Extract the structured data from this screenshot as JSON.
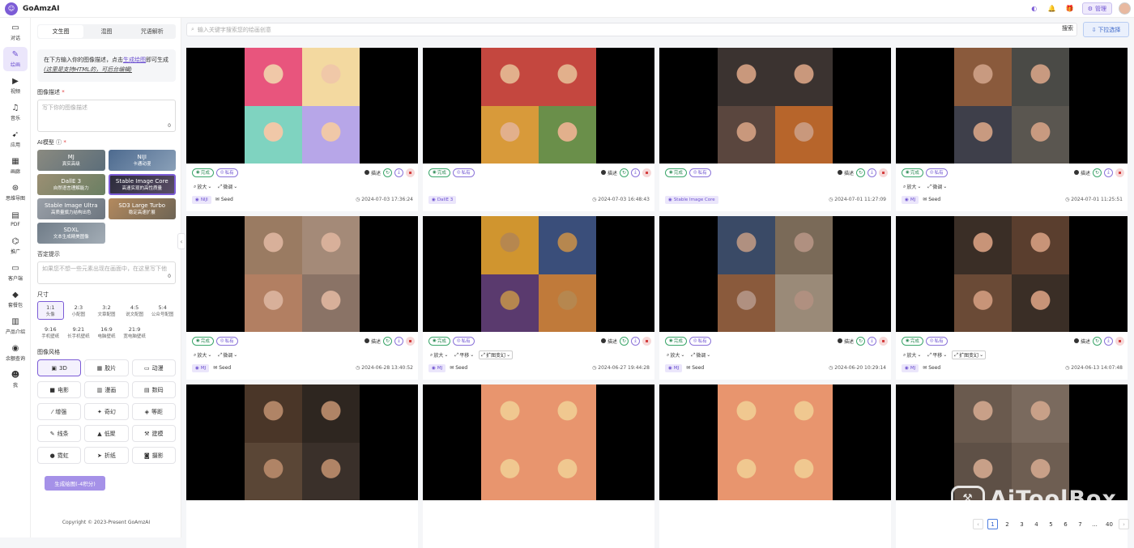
{
  "app": {
    "title": "GoAmzAI",
    "logo_icon": "robot-icon"
  },
  "header": {
    "manage_label": "管理"
  },
  "nav": [
    {
      "label": "对话",
      "icon": "chat-icon"
    },
    {
      "label": "绘画",
      "icon": "brush-icon",
      "active": true
    },
    {
      "label": "视频",
      "icon": "video-icon"
    },
    {
      "label": "音乐",
      "icon": "music-icon"
    },
    {
      "label": "应用",
      "icon": "rocket-icon"
    },
    {
      "label": "画廊",
      "icon": "gallery-icon"
    },
    {
      "label": "思维导图",
      "icon": "mindmap-icon"
    },
    {
      "label": "PDF",
      "icon": "pdf-icon"
    },
    {
      "label": "推广",
      "icon": "gift-icon"
    },
    {
      "label": "客户端",
      "icon": "monitor-icon"
    },
    {
      "label": "套餐包",
      "icon": "diamond-icon"
    },
    {
      "label": "产品介绍",
      "icon": "book-icon"
    },
    {
      "label": "余额查询",
      "icon": "balance-icon"
    },
    {
      "label": "我",
      "icon": "user-icon"
    }
  ],
  "panel": {
    "tabs": [
      "文生图",
      "混图",
      "咒语解析"
    ],
    "tip_prefix": "在下方输入你的图像描述，点击",
    "tip_link": "生成绘图",
    "tip_mid": "即可生成",
    "tip_note": "(这里是支持HTML的，可后台编辑)",
    "desc_label": "图像描述",
    "desc_placeholder": "写下你的图像描述",
    "desc_count": "0",
    "model_label": "AI模型",
    "models": [
      {
        "name": "MJ",
        "sub": "真实高级"
      },
      {
        "name": "NIJI",
        "sub": "卡通动漫"
      },
      {
        "name": "DallE 3",
        "sub": "自然语言理解能力"
      },
      {
        "name": "Stable Image Core",
        "sub": "高速实现的高性质量"
      },
      {
        "name": "Stable Image Ultra",
        "sub": "高质量旗力结构出色"
      },
      {
        "name": "SD3 Large Turbo",
        "sub": "稳定高速扩展"
      },
      {
        "name": "SDXL",
        "sub": "文本生成精美图像"
      }
    ],
    "neg_label": "否定提示",
    "neg_placeholder": "如果您不想一些元素出现在画面中，在这里写下他",
    "neg_count": "0",
    "size_label": "尺寸",
    "sizes": [
      {
        "ratio": "1:1",
        "name": "头像"
      },
      {
        "ratio": "2:3",
        "name": "小配图"
      },
      {
        "ratio": "3:2",
        "name": "文章配图"
      },
      {
        "ratio": "4:5",
        "name": "说文配图"
      },
      {
        "ratio": "5:4",
        "name": "公众号配图"
      },
      {
        "ratio": "9:16",
        "name": "手机壁纸"
      },
      {
        "ratio": "9:21",
        "name": "长手机壁纸"
      },
      {
        "ratio": "16:9",
        "name": "电脑壁纸"
      },
      {
        "ratio": "21:9",
        "name": "宽电脑壁纸"
      }
    ],
    "style_label": "图像风格",
    "styles": [
      {
        "name": "3D",
        "icon": "cube-icon"
      },
      {
        "name": "胶片",
        "icon": "film-icon"
      },
      {
        "name": "动漫",
        "icon": "tv-icon"
      },
      {
        "name": "电影",
        "icon": "camera-icon"
      },
      {
        "name": "漫画",
        "icon": "book-open-icon"
      },
      {
        "name": "数码",
        "icon": "chip-icon"
      },
      {
        "name": "增强",
        "icon": "wand-icon"
      },
      {
        "name": "奇幻",
        "icon": "dragon-icon"
      },
      {
        "name": "等距",
        "icon": "iso-icon"
      },
      {
        "name": "线条",
        "icon": "pen-icon"
      },
      {
        "name": "低聚",
        "icon": "shapes-icon"
      },
      {
        "name": "建模",
        "icon": "hammer-icon"
      },
      {
        "name": "霓虹",
        "icon": "bulb-icon"
      },
      {
        "name": "折纸",
        "icon": "paper-plane-icon"
      },
      {
        "name": "摄影",
        "icon": "photo-camera-icon"
      }
    ],
    "generate_label": "生成绘图(-4积分)",
    "copyright": "Copyright © 2023-Present GoAmzAI"
  },
  "search": {
    "placeholder": "输入关键字搜索您的绘画创意",
    "button": "搜索",
    "dropdown": "下拉选择"
  },
  "cards": [
    {
      "model": "NIJI",
      "date": "2024-07-03 17:36:24",
      "controls": [
        "放大",
        "微调"
      ],
      "seed": true,
      "colors": [
        "#e8557d",
        "#f3d9a0",
        "#7fd3c0",
        "#b7a6e8"
      ],
      "skin": "#f0c8a8"
    },
    {
      "model": "DallE 3",
      "date": "2024-07-03 16:48:43",
      "controls": [],
      "seed": false,
      "colors": [
        "#c4473f",
        "#c4473f",
        "#d89a3a",
        "#6a8f4a"
      ],
      "skin": "#e2b08c"
    },
    {
      "model": "Stable Image Core",
      "date": "2024-07-01 11:27:09",
      "controls": [],
      "seed": false,
      "colors": [
        "#3b3330",
        "#3b3330",
        "#5a463e",
        "#b7652b"
      ],
      "skin": "#c9987c"
    },
    {
      "model": "MJ",
      "date": "2024-07-01 11:25:51",
      "controls": [
        "放大",
        "微调"
      ],
      "seed": true,
      "colors": [
        "#8a5a3c",
        "#4a4a46",
        "#3e3f4a",
        "#5a5650"
      ],
      "skin": "#c89a80"
    },
    {
      "model": "MJ",
      "date": "2024-06-28 13:40:52",
      "controls": [
        "放大",
        "微调"
      ],
      "seed": true,
      "colors": [
        "#9a7b62",
        "#a48a78",
        "#b27f62",
        "#8a7366"
      ],
      "skin": "#d8b09a"
    },
    {
      "model": "MJ",
      "date": "2024-06-27 19:44:28",
      "controls": [
        "放大",
        "平移",
        "扩图变幻"
      ],
      "seed": true,
      "colors": [
        "#d0952f",
        "#3a4e7a",
        "#5a3a6e",
        "#c07a3a"
      ],
      "skin": "#b6874f"
    },
    {
      "model": "MJ",
      "date": "2024-06-20 10:29:14",
      "controls": [
        "放大",
        "微调"
      ],
      "seed": true,
      "colors": [
        "#3a4a66",
        "#7a6a58",
        "#8a5a3c",
        "#9a8a78"
      ],
      "skin": "#b09080"
    },
    {
      "model": "MJ",
      "date": "2024-06-13 14:07:48",
      "controls": [
        "放大",
        "平移",
        "扩图变幻"
      ],
      "seed": true,
      "colors": [
        "#3a2e26",
        "#5a3e2e",
        "#6a4a36",
        "#3a2e26"
      ],
      "skin": "#c89478"
    },
    {
      "model": "",
      "date": "",
      "controls": [],
      "seed": false,
      "colors": [
        "#4a3628",
        "#2e2620",
        "#5a4636",
        "#3a302a"
      ],
      "skin": "#b08466"
    },
    {
      "model": "",
      "date": "",
      "controls": [],
      "seed": false,
      "colors": [
        "#e8956e",
        "#e8956e",
        "#e8956e",
        "#e8956e"
      ],
      "skin": "#f0c890"
    },
    {
      "model": "",
      "date": "",
      "controls": [],
      "seed": false,
      "colors": [
        "#e8956e",
        "#e8956e",
        "#e8956e",
        "#e8956e"
      ],
      "skin": "#f0c890"
    },
    {
      "model": "",
      "date": "",
      "controls": [],
      "seed": false,
      "colors": [
        "#6a5a4e",
        "#7a6a5e",
        "#5e5046",
        "#6e5e52"
      ],
      "skin": "#c8a088"
    }
  ],
  "card_labels": {
    "done": "完成",
    "private": "私有",
    "describe": "描述",
    "seed": "Seed"
  },
  "pagination": {
    "pages": [
      "1",
      "2",
      "3",
      "4",
      "5",
      "6",
      "7",
      "...",
      "40"
    ],
    "current": "1"
  },
  "watermark": "AiToolBox"
}
